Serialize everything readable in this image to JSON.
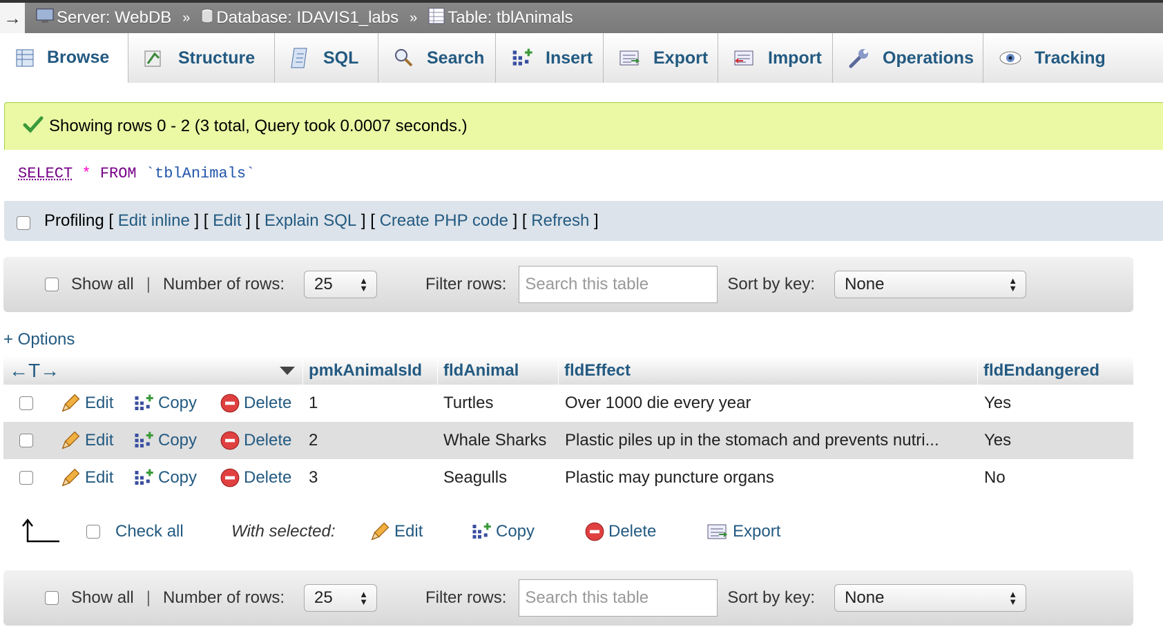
{
  "breadcrumb": {
    "toggle": "→",
    "server": "Server: WebDB",
    "database": "Database: IDAVIS1_labs",
    "table": "Table: tblAnimals",
    "separator": "»"
  },
  "tabs": [
    {
      "label": "Browse",
      "icon": "browse-icon"
    },
    {
      "label": "Structure",
      "icon": "structure-icon"
    },
    {
      "label": "SQL",
      "icon": "sql-icon"
    },
    {
      "label": "Search",
      "icon": "search-icon"
    },
    {
      "label": "Insert",
      "icon": "insert-icon"
    },
    {
      "label": "Export",
      "icon": "export-icon"
    },
    {
      "label": "Import",
      "icon": "import-icon"
    },
    {
      "label": "Operations",
      "icon": "wrench-icon"
    },
    {
      "label": "Tracking",
      "icon": "eye-icon"
    }
  ],
  "message": "Showing rows 0 - 2 (3 total, Query took 0.0007 seconds.)",
  "sql": {
    "select": "SELECT",
    "star": "*",
    "from": "FROM",
    "table": "`tblAnimals`"
  },
  "profiling": {
    "label": "Profiling",
    "links": [
      "Edit inline",
      "Edit",
      "Explain SQL",
      "Create PHP code",
      "Refresh"
    ]
  },
  "nav": {
    "show_all": "Show all",
    "separator": "|",
    "rows_label": "Number of rows:",
    "rows_value": "25",
    "filter_label": "Filter rows:",
    "filter_placeholder": "Search this table",
    "sort_label": "Sort by key:",
    "sort_value": "None"
  },
  "options_label": "+ Options",
  "table": {
    "nav_arrows": "←T→",
    "columns": [
      "pmkAnimalsId",
      "fldAnimal",
      "fldEffect",
      "fldEndangered"
    ],
    "actions": {
      "edit": "Edit",
      "copy": "Copy",
      "delete": "Delete"
    },
    "rows": [
      [
        "1",
        "Turtles",
        "Over 1000 die every year",
        "Yes"
      ],
      [
        "2",
        "Whale Sharks",
        "Plastic piles up in the stomach and prevents nutri...",
        "Yes"
      ],
      [
        "3",
        "Seagulls",
        "Plastic may puncture organs",
        "No"
      ]
    ]
  },
  "bulk": {
    "check_all": "Check all",
    "with_selected": "With selected:",
    "edit": "Edit",
    "copy": "Copy",
    "delete": "Delete",
    "export": "Export"
  },
  "colors": {
    "link": "#235a81",
    "success_bg": "#ebf8a4",
    "topbar": "#808080"
  }
}
